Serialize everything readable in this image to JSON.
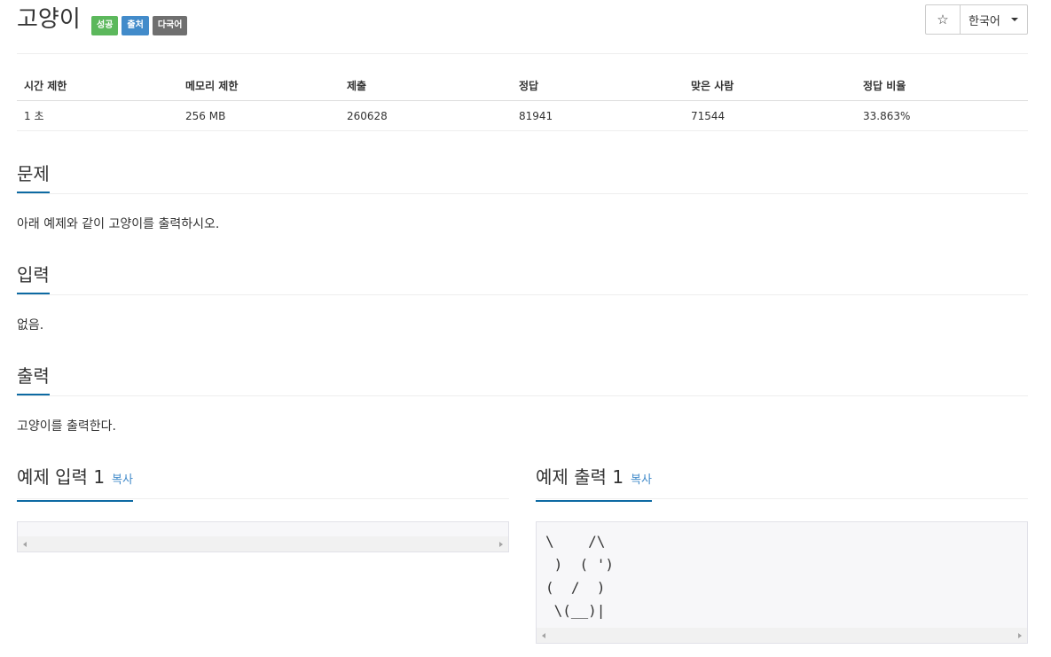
{
  "problem": {
    "title": "고양이",
    "labels": [
      {
        "text": "성공",
        "color": "#5cb85c"
      },
      {
        "text": "출처",
        "color": "#428bca"
      },
      {
        "text": "다국어",
        "color": "#6f6f6f"
      }
    ]
  },
  "actions": {
    "star_icon": "☆",
    "language": "한국어"
  },
  "info_table": {
    "headers": [
      "시간 제한",
      "메모리 제한",
      "제출",
      "정답",
      "맞은 사람",
      "정답 비율"
    ],
    "values": [
      "1 초",
      "256 MB",
      "260628",
      "81941",
      "71544",
      "33.863%"
    ]
  },
  "sections": {
    "description": {
      "title": "문제",
      "text": "아래 예제와 같이 고양이를 출력하시오."
    },
    "input": {
      "title": "입력",
      "text": "없음."
    },
    "output": {
      "title": "출력",
      "text": "고양이를 출력한다."
    }
  },
  "samples": {
    "input": {
      "title": "예제 입력 1",
      "copy": "복사",
      "content": ""
    },
    "output": {
      "title": "예제 출력 1",
      "copy": "복사",
      "content": "\\    /\\\n )  ( ')\n(  /  )\n \\(__)|"
    }
  },
  "colors": {
    "accent": "#0d6aa3",
    "link": "#428bca"
  }
}
